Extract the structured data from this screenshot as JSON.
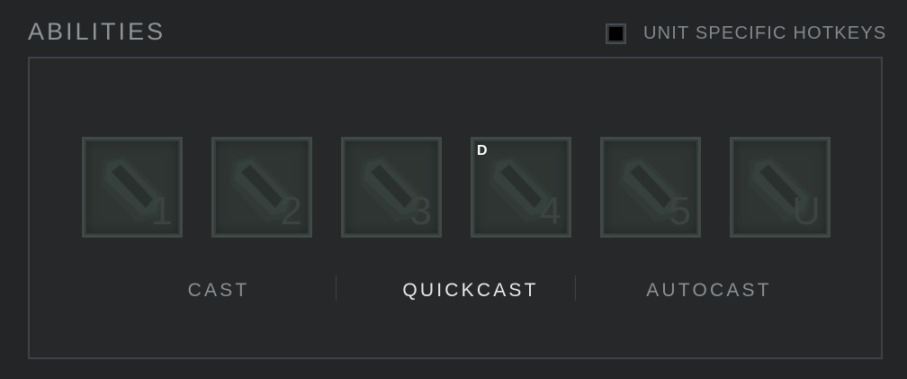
{
  "section": {
    "title": "ABILITIES"
  },
  "unit_hotkeys": {
    "label": "UNIT SPECIFIC HOTKEYS",
    "checked": false
  },
  "ability_slots": [
    {
      "key": "1",
      "icon": "dota-logo-icon"
    },
    {
      "key": "2",
      "icon": "dota-logo-icon"
    },
    {
      "key": "3",
      "icon": "dota-logo-icon"
    },
    {
      "key": "4",
      "icon": "dota-logo-icon",
      "badge": "D"
    },
    {
      "key": "5",
      "icon": "dota-logo-icon"
    },
    {
      "key": "U",
      "icon": "dota-logo-icon"
    }
  ],
  "cast_modes": {
    "options": [
      "CAST",
      "QUICKCAST",
      "AUTOCAST"
    ],
    "selected": "QUICKCAST"
  },
  "colors": {
    "background": "#232527",
    "panel_border": "#3e4246",
    "slot_fill": "#2e3533",
    "text_muted": "#8a9094",
    "text_active": "#e8eaec"
  }
}
